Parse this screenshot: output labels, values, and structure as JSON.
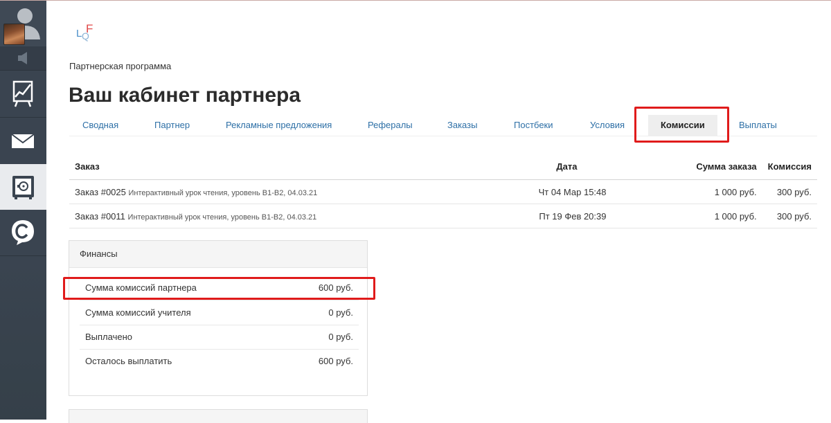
{
  "sidebar": {
    "items": [
      {
        "icon": "user-icon"
      },
      {
        "icon": "speaker-icon"
      },
      {
        "icon": "stats-chart-icon"
      },
      {
        "icon": "mail-icon"
      },
      {
        "icon": "safe-icon",
        "active": true
      },
      {
        "icon": "chat-icon"
      }
    ]
  },
  "logo": {
    "text": "LQF"
  },
  "breadcrumb": "Партнерская программа",
  "page_title": "Ваш кабинет партнера",
  "tabs": [
    {
      "label": "Сводная"
    },
    {
      "label": "Партнер"
    },
    {
      "label": "Рекламные предложения"
    },
    {
      "label": "Рефералы"
    },
    {
      "label": "Заказы"
    },
    {
      "label": "Постбеки"
    },
    {
      "label": "Условия"
    },
    {
      "label": "Комиссии",
      "active": true
    },
    {
      "label": "Выплаты"
    }
  ],
  "orders_table": {
    "headers": [
      "Заказ",
      "Дата",
      "Сумма заказа",
      "Комиссия"
    ],
    "rows": [
      {
        "order": "Заказ #0025",
        "description": "Интерактивный урок чтения, уровень B1-B2, 04.03.21",
        "date": "Чт 04 Мар 15:48",
        "sum": "1 000 руб.",
        "commission": "300 руб."
      },
      {
        "order": "Заказ #0011",
        "description": "Интерактивный урок чтения, уровень B1-B2, 04.03.21",
        "date": "Пт 19 Фев 20:39",
        "sum": "1 000 руб.",
        "commission": "300 руб."
      }
    ]
  },
  "finance": {
    "title": "Финансы",
    "rows": [
      {
        "label": "Сумма комиссий партнера",
        "value": "600 руб."
      },
      {
        "label": "Сумма комиссий учителя",
        "value": "0 руб."
      },
      {
        "label": "Выплачено",
        "value": "0 руб."
      },
      {
        "label": "Осталось выплатить",
        "value": "600 руб."
      }
    ]
  },
  "colors": {
    "sidebar": "#3a4450",
    "link": "#2d6fa6",
    "highlight": "#e01b1b"
  }
}
